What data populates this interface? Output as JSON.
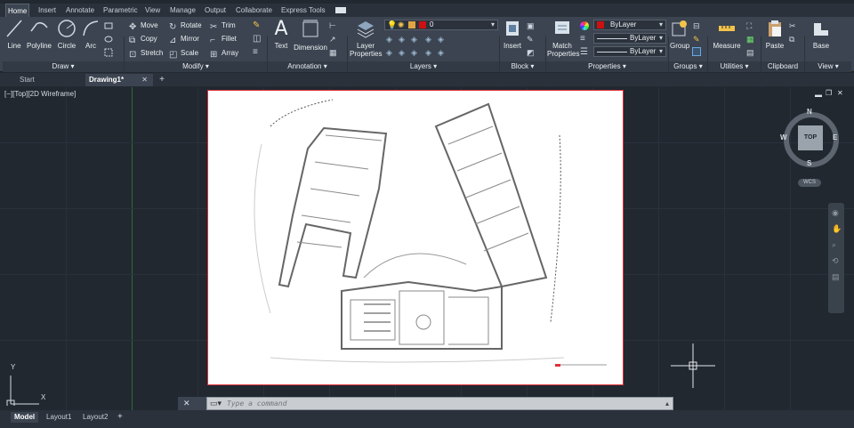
{
  "ribbon_tabs": [
    "Home",
    "Insert",
    "Annotate",
    "Parametric",
    "View",
    "Manage",
    "Output",
    "Collaborate",
    "Express Tools"
  ],
  "draw": {
    "line": "Line",
    "polyline": "Polyline",
    "circle": "Circle",
    "arc": "Arc",
    "panel": "Draw ▾"
  },
  "modify": {
    "move": "Move",
    "rotate": "Rotate",
    "trim": "Trim",
    "copy": "Copy",
    "mirror": "Mirror",
    "fillet": "Fillet",
    "stretch": "Stretch",
    "scale": "Scale",
    "array": "Array",
    "panel": "Modify ▾"
  },
  "annotation": {
    "text": "Text",
    "dimension": "Dimension",
    "panel": "Annotation ▾"
  },
  "layers": {
    "layer_properties": "Layer Properties",
    "current_layer": "0",
    "panel": "Layers ▾"
  },
  "block": {
    "insert": "Insert",
    "panel": "Block ▾"
  },
  "properties": {
    "match": "Match Properties",
    "color": "ByLayer",
    "linetype": "ByLayer",
    "lineweight": "ByLayer",
    "panel": "Properties ▾"
  },
  "groups": {
    "group": "Group",
    "panel": "Groups ▾"
  },
  "utilities": {
    "measure": "Measure",
    "panel": "Utilities ▾"
  },
  "clipboard": {
    "paste": "Paste",
    "panel": "Clipboard"
  },
  "view_panel": {
    "base": "Base",
    "panel": "View ▾"
  },
  "doc_tabs": {
    "start": "Start",
    "drawing": "Drawing1*"
  },
  "viewport": {
    "label": "[−][Top][2D Wireframe]"
  },
  "viewcube": {
    "n": "N",
    "s": "S",
    "e": "E",
    "w": "W",
    "top": "TOP",
    "wcs": "WCS"
  },
  "ucs": {
    "x": "X",
    "y": "Y"
  },
  "command": {
    "placeholder": "Type a command"
  },
  "layout_tabs": [
    "Model",
    "Layout1",
    "Layout2"
  ],
  "colors": {
    "accent": "#e0303a",
    "background": "#212830",
    "ribbon": "#3b4450",
    "layer_color": "#cc1111"
  }
}
